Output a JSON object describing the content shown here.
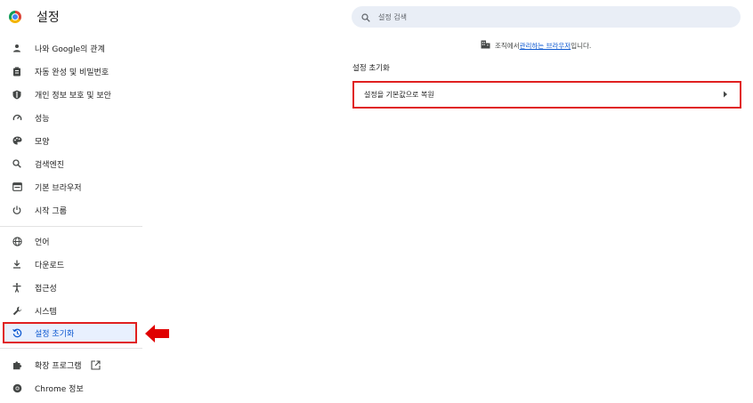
{
  "app": {
    "title": "설정"
  },
  "search": {
    "placeholder": "설정 검색"
  },
  "managed_notice": {
    "prefix": "조직에서 ",
    "link": "관리하는 브라우저",
    "suffix": "입니다."
  },
  "sidebar": {
    "items": [
      {
        "label": "나와 Google의 관계",
        "icon": "person-icon"
      },
      {
        "label": "자동 완성 및 비밀번호",
        "icon": "clipboard-icon"
      },
      {
        "label": "개인 정보 보호 및 보안",
        "icon": "shield-icon"
      },
      {
        "label": "성능",
        "icon": "speedometer-icon"
      },
      {
        "label": "모양",
        "icon": "palette-icon"
      },
      {
        "label": "검색엔진",
        "icon": "search-icon"
      },
      {
        "label": "기본 브라우저",
        "icon": "browser-icon"
      },
      {
        "label": "시작 그룹",
        "icon": "power-icon"
      },
      {
        "label": "언어",
        "icon": "globe-icon"
      },
      {
        "label": "다운로드",
        "icon": "download-icon"
      },
      {
        "label": "접근성",
        "icon": "accessibility-icon"
      },
      {
        "label": "시스템",
        "icon": "wrench-icon"
      },
      {
        "label": "설정 초기화",
        "icon": "reset-icon",
        "active": true
      },
      {
        "label": "확장 프로그램",
        "icon": "puzzle-icon"
      },
      {
        "label": "Chrome 정보",
        "icon": "chrome-icon"
      }
    ]
  },
  "main": {
    "section_title": "설정 초기화",
    "reset_row": {
      "label": "설정을 기본값으로 복원"
    }
  },
  "colors": {
    "annotation_red": "#e02020",
    "active_blue": "#0b57d0",
    "active_bg": "#e8f0fe"
  }
}
